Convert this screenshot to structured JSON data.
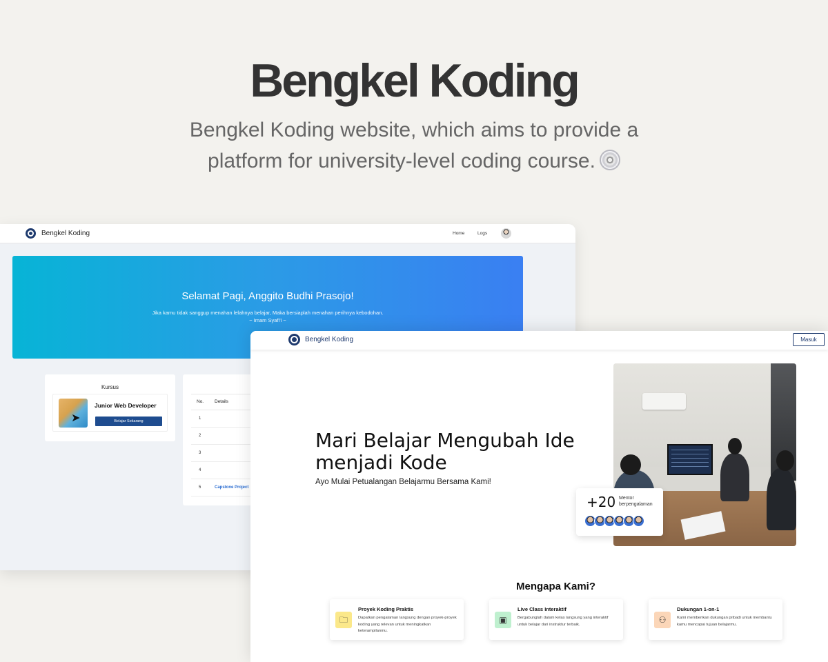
{
  "hero": {
    "title": "Bengkel Koding",
    "subtitle": "Bengkel Koding website, which aims to provide a platform for university-level coding course.",
    "subtitle_icon": "disc-icon"
  },
  "dashboard": {
    "brand": "Bengkel Koding",
    "nav": {
      "home": "Home",
      "logs": "Logs"
    },
    "banner": {
      "greeting": "Selamat Pagi, Anggito Budhi Prasojo!",
      "quote": "Jika kamu tidak sanggup menahan lelahnya belajar, Maka bersiaplah menahan perihnya kebodohan.",
      "author": "~ Imam Syafi'i ~",
      "gradient": [
        "#07b4d6",
        "#3a7ff2"
      ]
    },
    "kursus": {
      "title": "Kursus",
      "course_name": "Junior Web Developer",
      "button": "Belajar Sekarang"
    },
    "table": {
      "headers": [
        "No.",
        "Details"
      ],
      "rows": [
        {
          "no": "1",
          "detail": ""
        },
        {
          "no": "2",
          "detail": ""
        },
        {
          "no": "3",
          "detail": ""
        },
        {
          "no": "4",
          "detail": ""
        },
        {
          "no": "5",
          "detail": "Capstone Project"
        }
      ]
    }
  },
  "landing": {
    "brand": "Bengkel Koding",
    "login_button": "Masuk",
    "headline": "Mari Belajar Mengubah Ide menjadi Kode",
    "tagline": "Ayo Mulai Petualangan Belajarmu Bersama Kami!",
    "stat": {
      "number": "+20",
      "label": "Mentor berpengalaman"
    },
    "why_title": "Mengapa Kami?",
    "features": [
      {
        "title": "Proyek Koding Praktis",
        "desc": "Dapatkan pengalaman langsung dengan proyek-proyek koding yang relevan untuk meningkatkan keterampilanmu.",
        "icon": "folder-code-icon",
        "color": "#fbe88a"
      },
      {
        "title": "Live Class Interaktif",
        "desc": "Bergabunglah dalam kelas langsung yang interaktif untuk belajar dari instruktur terbaik.",
        "icon": "video-class-icon",
        "color": "#bff0cf"
      },
      {
        "title": "Dukungan 1-on-1",
        "desc": "Kami memberikan dukungan pribadi untuk membantu kamu mencapai tujuan belajarmu.",
        "icon": "people-support-icon",
        "color": "#fbd6b8"
      }
    ],
    "accent": "#1e3a6e"
  }
}
